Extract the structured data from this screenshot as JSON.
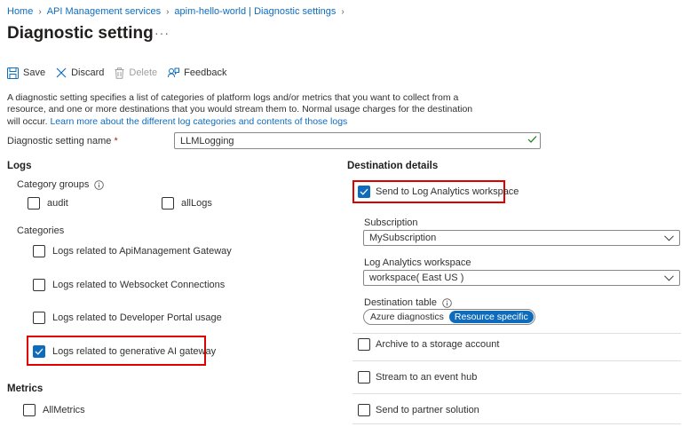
{
  "breadcrumb": {
    "items": [
      "Home",
      "API Management services",
      "apim-hello-world | Diagnostic settings"
    ]
  },
  "page": {
    "title": "Diagnostic setting",
    "more": "···"
  },
  "toolbar": {
    "save": "Save",
    "discard": "Discard",
    "delete": "Delete",
    "feedback": "Feedback"
  },
  "description": {
    "text": "A diagnostic setting specifies a list of categories of platform logs and/or metrics that you want to collect from a resource, and one or more destinations that you would stream them to. Normal usage charges for the destination will occur. ",
    "link": "Learn more about the different log categories and contents of those logs"
  },
  "setting_name": {
    "label": "Diagnostic setting name",
    "required_mark": "*",
    "value": "LLMLogging"
  },
  "logs": {
    "title": "Logs",
    "category_groups_label": "Category groups",
    "category_groups": [
      {
        "label": "audit",
        "checked": false
      },
      {
        "label": "allLogs",
        "checked": false
      }
    ],
    "categories_label": "Categories",
    "categories": [
      {
        "label": "Logs related to ApiManagement Gateway",
        "checked": false
      },
      {
        "label": "Logs related to Websocket Connections",
        "checked": false
      },
      {
        "label": "Logs related to Developer Portal usage",
        "checked": false
      },
      {
        "label": "Logs related to generative AI gateway",
        "checked": true
      }
    ]
  },
  "metrics": {
    "title": "Metrics",
    "items": [
      {
        "label": "AllMetrics",
        "checked": false
      }
    ]
  },
  "destination": {
    "title": "Destination details",
    "log_analytics": {
      "label": "Send to Log Analytics workspace",
      "checked": true
    },
    "subscription_label": "Subscription",
    "subscription_value": "MySubscription",
    "workspace_label": "Log Analytics workspace",
    "workspace_value": "workspace( East US )",
    "table_label": "Destination table",
    "table_options": [
      "Azure diagnostics",
      "Resource specific"
    ],
    "table_selected": "Resource specific",
    "archive": {
      "label": "Archive to a storage account",
      "checked": false
    },
    "event_hub": {
      "label": "Stream to an event hub",
      "checked": false
    },
    "partner": {
      "label": "Send to partner solution",
      "checked": false
    }
  },
  "colors": {
    "accent": "#0f6cbd",
    "highlight": "#e00000",
    "valid": "#107c10"
  }
}
